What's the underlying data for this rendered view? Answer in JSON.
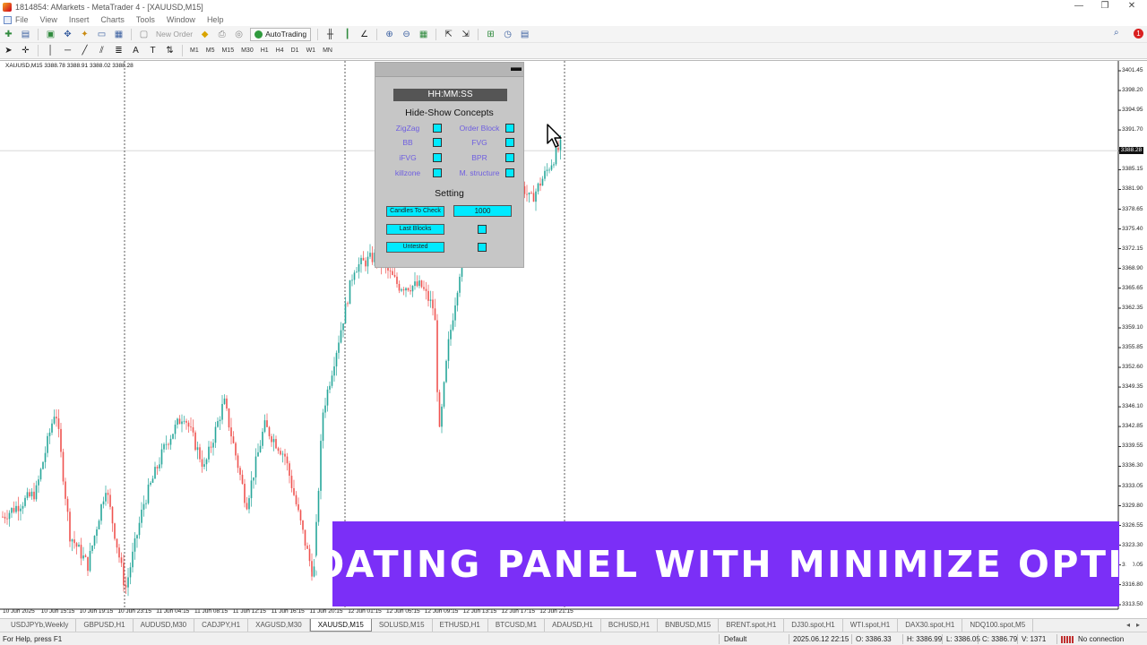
{
  "window": {
    "title": "1814854: AMarkets - MetaTrader 4 - [XAUUSD,M15]",
    "controls": [
      "—",
      "❐",
      "✕"
    ]
  },
  "menu": [
    "File",
    "View",
    "Insert",
    "Charts",
    "Tools",
    "Window",
    "Help"
  ],
  "toolbar": {
    "new_order_label": "New Order",
    "autotrading_label": "AutoTrading",
    "alert_count": "1",
    "timeframes": [
      "M1",
      "M5",
      "M15",
      "M30",
      "H1",
      "H4",
      "D1",
      "W1",
      "MN"
    ]
  },
  "chart": {
    "info_line": "XAUUSD,M15  3388.78 3388.91 3388.02 3388.28",
    "current_price": "3388.28",
    "price_labels": [
      "3401.45",
      "3398.20",
      "3394.95",
      "3391.70",
      "3388.28",
      "3385.15",
      "3381.90",
      "3378.65",
      "3375.40",
      "3372.15",
      "3368.90",
      "3365.65",
      "3362.35",
      "3359.10",
      "3355.85",
      "3352.60",
      "3349.35",
      "3346.10",
      "3342.85",
      "3339.55",
      "3336.30",
      "3333.05",
      "3329.80",
      "3326.55",
      "3323.30",
      "3320.05",
      "3316.80",
      "3313.50"
    ],
    "time_labels": [
      "10 Jun 2025",
      "10 Jun 15:15",
      "10 Jun 19:15",
      "10 Jun 23:15",
      "11 Jun 04:15",
      "11 Jun 08:15",
      "11 Jun 12:15",
      "11 Jun 16:15",
      "11 Jun 20:15",
      "12 Jun 01:15",
      "12 Jun 05:15",
      "12 Jun 09:15",
      "12 Jun 13:15",
      "12 Jun 17:15",
      "12 Jun 21:15"
    ]
  },
  "panel": {
    "clock": "HH:MM:SS",
    "concepts_title": "Hide-Show Concepts",
    "concepts": [
      "ZigZag",
      "Order Block",
      "BB",
      "FVG",
      "iFVG",
      "BPR",
      "killzone",
      "M. structure"
    ],
    "setting_title": "Setting",
    "candles_label": "Candles To Check",
    "candles_value": "1000",
    "last_blocks_label": "Last Blocks",
    "untested_label": "Untested"
  },
  "banner": {
    "text": "FLOATING PANEL WITH MINIMIZE OPTION",
    "color": "#7b2ff7"
  },
  "tabs": [
    "USDJPYb,Weekly",
    "GBPUSD,H1",
    "AUDUSD,M30",
    "CADJPY,H1",
    "XAGUSD,M30",
    "XAUUSD,M15",
    "SOLUSD,M15",
    "ETHUSD,H1",
    "BTCUSD,M1",
    "ADAUSD,H1",
    "BCHUSD,H1",
    "BNBUSD,M15",
    "BRENT.spot,H1",
    "DJ30.spot,H1",
    "WTI.spot,H1",
    "DAX30.spot,H1",
    "NDQ100.spot,M5"
  ],
  "active_tab": "XAUUSD,M15",
  "status": {
    "help": "For Help, press F1",
    "profile": "Default",
    "datetime": "2025.06.12 22:15",
    "open": "O: 3386.33",
    "high": "H: 3386.99",
    "low": "L: 3386.05",
    "close": "C: 3386.79",
    "volume": "V: 1371",
    "connection": "No connection"
  },
  "colors": {
    "bull": "#26a69a",
    "bear": "#ef5350",
    "panel_accent": "#00eaff",
    "concept_label": "#6e5ee0"
  }
}
